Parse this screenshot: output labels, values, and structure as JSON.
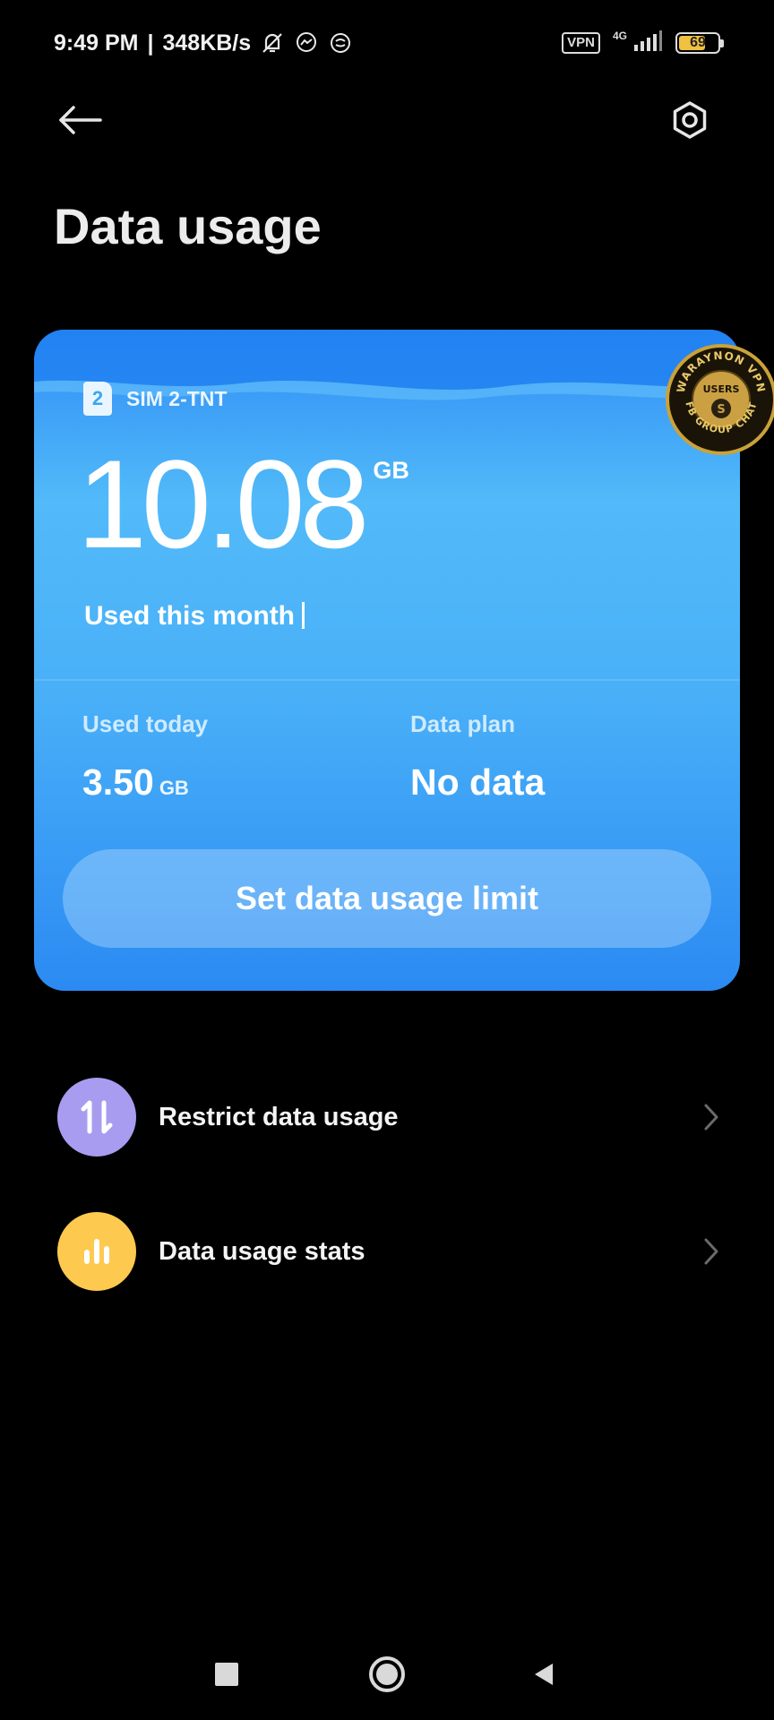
{
  "status_bar": {
    "time": "9:49 PM",
    "separator": "|",
    "speed": "348KB/s",
    "vpn": "VPN",
    "network": "4G",
    "battery": "69",
    "battery_level": 0.69,
    "icons": [
      "bell-off-icon",
      "messenger-icon",
      "chat-bubble-icon",
      "vpn-badge",
      "signal-icon",
      "battery-icon"
    ]
  },
  "header": {
    "title": "Data usage",
    "back_icon": "arrow-left-icon",
    "settings_icon": "gear-icon"
  },
  "card": {
    "sim_number": "2",
    "sim_label": "SIM 2-TNT",
    "used_value": "10.08",
    "used_unit": "GB",
    "used_caption": "Used this month",
    "today_label": "Used today",
    "today_value": "3.50",
    "today_unit": "GB",
    "plan_label": "Data plan",
    "plan_value": "No data",
    "limit_button": "Set data usage limit",
    "colors": {
      "top": "#2e8cf5",
      "middle": "#52baf9",
      "bottom": "#2b8af2"
    }
  },
  "watermark": {
    "text_top": "WARAYNON VPN",
    "text_center": "USERS",
    "text_bottom": "FB GROUP CHAT"
  },
  "menu": [
    {
      "label": "Restrict data usage",
      "icon": "up-down-arrows-icon",
      "color": "#a89cf0"
    },
    {
      "label": "Data usage stats",
      "icon": "bar-chart-icon",
      "color": "#fdc94f"
    }
  ],
  "nav": {
    "icons": [
      "recents-square-icon",
      "home-circle-icon",
      "back-triangle-icon"
    ]
  }
}
